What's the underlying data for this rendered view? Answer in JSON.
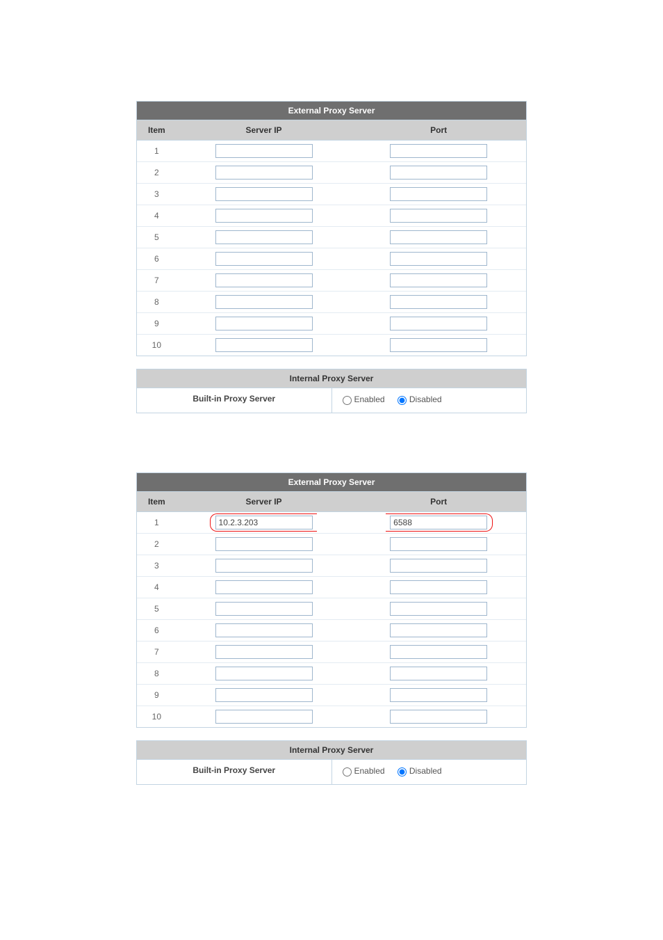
{
  "tables": {
    "external_title": "External Proxy Server",
    "internal_title": "Internal Proxy Server",
    "col_item": "Item",
    "col_ip": "Server IP",
    "col_port": "Port",
    "builtin_label": "Built-in Proxy Server",
    "enabled_label": "Enabled",
    "disabled_label": "Disabled"
  },
  "top": {
    "rows": [
      {
        "n": "1",
        "ip": "",
        "port": ""
      },
      {
        "n": "2",
        "ip": "",
        "port": ""
      },
      {
        "n": "3",
        "ip": "",
        "port": ""
      },
      {
        "n": "4",
        "ip": "",
        "port": ""
      },
      {
        "n": "5",
        "ip": "",
        "port": ""
      },
      {
        "n": "6",
        "ip": "",
        "port": ""
      },
      {
        "n": "7",
        "ip": "",
        "port": ""
      },
      {
        "n": "8",
        "ip": "",
        "port": ""
      },
      {
        "n": "9",
        "ip": "",
        "port": ""
      },
      {
        "n": "10",
        "ip": "",
        "port": ""
      }
    ],
    "builtin": "disabled"
  },
  "bottom": {
    "rows": [
      {
        "n": "1",
        "ip": "10.2.3.203",
        "port": "6588"
      },
      {
        "n": "2",
        "ip": "",
        "port": ""
      },
      {
        "n": "3",
        "ip": "",
        "port": ""
      },
      {
        "n": "4",
        "ip": "",
        "port": ""
      },
      {
        "n": "5",
        "ip": "",
        "port": ""
      },
      {
        "n": "6",
        "ip": "",
        "port": ""
      },
      {
        "n": "7",
        "ip": "",
        "port": ""
      },
      {
        "n": "8",
        "ip": "",
        "port": ""
      },
      {
        "n": "9",
        "ip": "",
        "port": ""
      },
      {
        "n": "10",
        "ip": "",
        "port": ""
      }
    ],
    "builtin": "disabled",
    "highlight_row": 0
  }
}
